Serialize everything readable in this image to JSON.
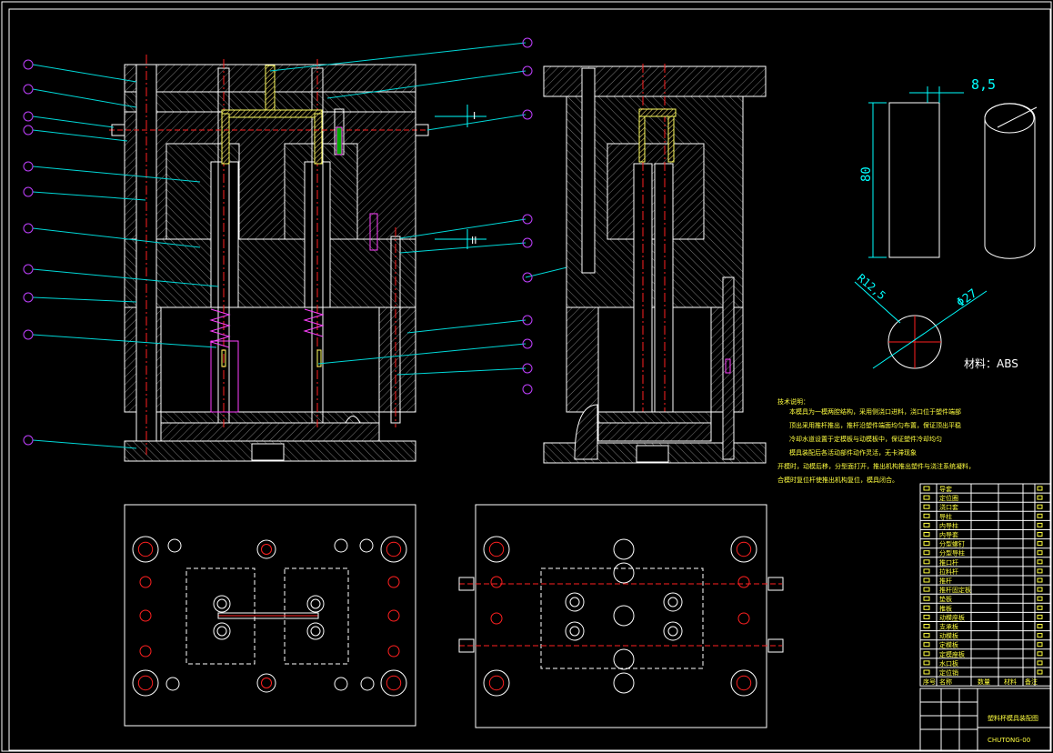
{
  "drawing": {
    "background": "#000000",
    "colors": {
      "outline": "#ffffff",
      "hatch": "#808080",
      "center": "#ff2020",
      "leader": "#00d8d8",
      "balloon": "#c040ff",
      "spring": "#ff40ff",
      "runner": "#ffff60",
      "text_yellow": "#ffff40",
      "dimension": "#00ffff"
    },
    "section_marks": {
      "cut_1": "I",
      "cut_2": "II"
    },
    "part_sketch": {
      "dim_width": "8,5",
      "dim_height": "80",
      "dim_radius": "R12,5",
      "dim_diameter": "Φ27",
      "material": "材料：ABS"
    },
    "notes": {
      "heading": "技术说明：",
      "lines": [
        "本模具为一模两腔结构，采用侧浇口进料，浇口位于塑件端部",
        "顶出采用推杆推出，推杆沿塑件端面均匀布置，保证顶出平稳",
        "冷却水道设置于定模板与动模板中，保证塑件冷却均匀",
        "模具装配后各活动部件动作灵活，无卡滞现象",
        "开模时，动模后移，分型面打开，推出机构推出塑件与浇注系统凝料，",
        "合模时复位杆使推出机构复位，模具闭合。"
      ]
    },
    "bom": {
      "rows": [
        "导套",
        "定位圈",
        "浇口套",
        "导柱",
        "内导柱",
        "内导套",
        "分型螺钉",
        "分型导柱",
        "推口杆",
        "拉料杆",
        "推杆",
        "推杆固定板",
        "垫板",
        "推板",
        "动模座板",
        "支承板",
        "动模板",
        "定模板",
        "定模座板",
        "水口板",
        "定位销"
      ],
      "header": [
        "序号",
        "名称",
        "数量",
        "材料",
        "备注"
      ]
    },
    "title_block": {
      "name": "塑料杯模具装配图",
      "drawing_no": "CHUTONG-00"
    }
  }
}
